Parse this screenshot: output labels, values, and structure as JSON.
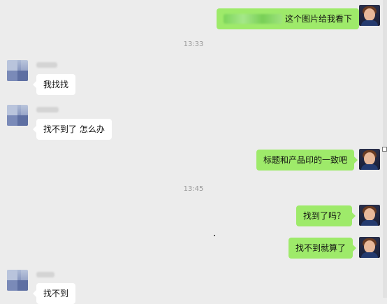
{
  "chat": {
    "timestamps": [
      "13:33",
      "13:45"
    ],
    "messages": [
      {
        "side": "out",
        "text": "这个图片给我看下",
        "has_blurred_prefix": true
      },
      {
        "side": "in",
        "text": "我找找"
      },
      {
        "side": "in",
        "text": "找不到了  怎么办"
      },
      {
        "side": "out",
        "text": "标题和产品印的一致吧"
      },
      {
        "side": "out",
        "text": "找到了吗？"
      },
      {
        "side": "out",
        "text": "找不到就算了"
      },
      {
        "side": "in",
        "text": "找不到"
      }
    ]
  }
}
